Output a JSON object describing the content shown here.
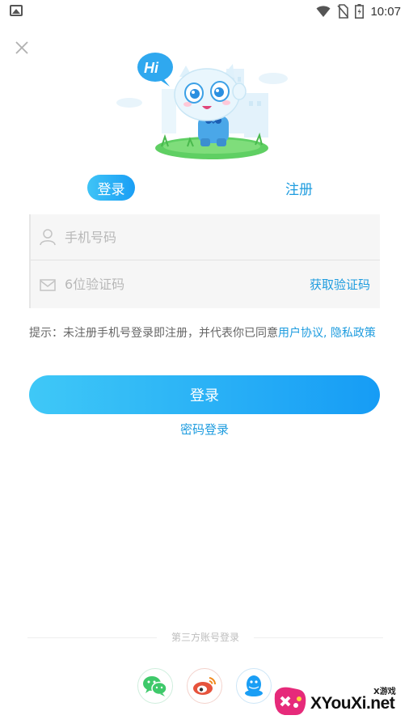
{
  "status_bar": {
    "time": "10:07"
  },
  "tabs": {
    "login": "登录",
    "register": "注册"
  },
  "form": {
    "phone_placeholder": "手机号码",
    "code_placeholder": "6位验证码",
    "get_code": "获取验证码"
  },
  "tip": {
    "prefix": "提示：未注册手机号登录即注册，并代表你已同意",
    "user_agreement": "用户协议",
    "separator": ", ",
    "privacy_policy": "隐私政策"
  },
  "login_button": "登录",
  "password_login": "密码登录",
  "third_party_label": "第三方账号登录",
  "mascot": {
    "speech": "Hi"
  },
  "watermark": {
    "tag": "X游戏",
    "text": "XYouXi.net"
  },
  "colors": {
    "accent": "#1e9cdf",
    "button_start": "#3fc8f7",
    "button_end": "#169cf5",
    "wechat": "#3ec96a",
    "weibo": "#e6533c",
    "qq": "#1a9ef5"
  }
}
